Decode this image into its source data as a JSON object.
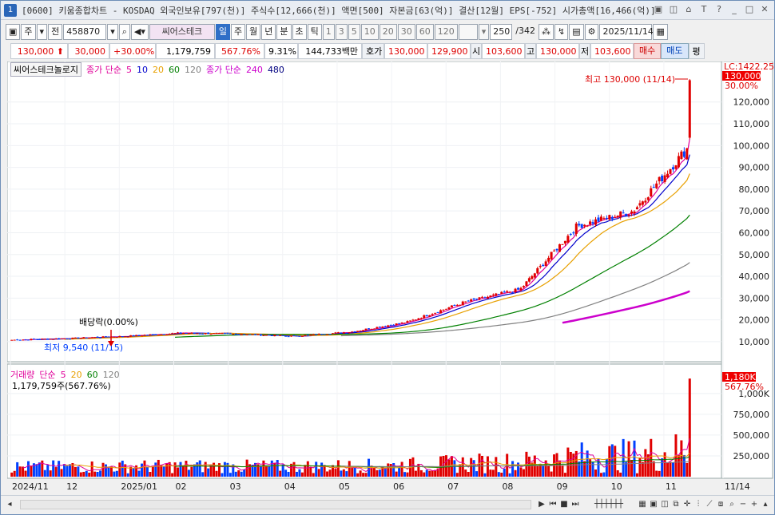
{
  "window": {
    "app_number": "1",
    "title": "[0600] 키움종합차트 - KOSDAQ 외국인보유[797(천)] 주식수[12,666(천)] 액면[500] 자본금[63(억)] 결산[12월] EPS[-752] 시가총액[16,466(억)]",
    "buttons": [
      "▣",
      "◫",
      "⌂",
      "T",
      "?",
      "_",
      "□",
      "✕"
    ]
  },
  "toolbar": {
    "period_combo": "주",
    "prev_label": "전",
    "code_value": "458870",
    "stock_name": "씨어스테크",
    "buttons": [
      "일",
      "주",
      "월",
      "년",
      "분",
      "초",
      "틱"
    ],
    "selected_period": "일",
    "numbers": [
      "1",
      "3",
      "5",
      "10",
      "20",
      "30",
      "60",
      "120"
    ],
    "count_value": "250",
    "count_total": "/342",
    "date_value": "2025/11/14"
  },
  "quote": {
    "price": "130,000",
    "change": "30,000",
    "change_pct": "+30.00%",
    "volume": "1,179,759",
    "vol_ratio": "567.76%",
    "turnover": "9.31%",
    "amount": "144,733백만",
    "ask_label": "호가",
    "ask": "130,000",
    "bid": "129,900",
    "open_label": "시",
    "open": "103,600",
    "high_label": "고",
    "high": "130,000",
    "low_label": "저",
    "low": "103,600",
    "buy_label": "매수",
    "sell_label": "매도",
    "eval_label": "평"
  },
  "legend_price": {
    "name": "씨어스테크놀로지",
    "ma_label": "종가 단순",
    "ma_periods": [
      "5",
      "10",
      "20",
      "60",
      "120"
    ],
    "ma2_label": "종가 단순",
    "ma2_periods": [
      "240",
      "480"
    ]
  },
  "legend_volume": {
    "name": "거래량",
    "ma_label": "단순",
    "ma_periods": [
      "5",
      "20",
      "60",
      "120"
    ],
    "info": "1,179,759주(567.76%)"
  },
  "annotations": {
    "high_note": "최고 130,000 (11/14)",
    "low_note": "최저 9,540 (11/15)",
    "dividend_note": "배당락(0.00%)",
    "lc_label": "LC:1422.25",
    "price_tag": "130,000",
    "pct_tag": "30.00%",
    "vol_tag": "1,180K",
    "vol_pct_tag": "567.76%"
  },
  "colors": {
    "up": "#e00000",
    "down": "#0040ff",
    "ma5": "#e0009a",
    "ma10": "#0000cc",
    "ma20": "#e8a000",
    "ma60": "#008000",
    "ma120": "#808080",
    "ma240": "#cc00cc",
    "ma480": "#000080"
  },
  "chart_data": [
    {
      "type": "candlestick",
      "title": "씨어스테크놀로지",
      "x": [
        "2024/11",
        "12",
        "2025/01",
        "02",
        "03",
        "04",
        "05",
        "06",
        "07",
        "08",
        "09",
        "10",
        "11",
        "11/14"
      ],
      "y_ticks": [
        "10,000",
        "20,000",
        "30,000",
        "40,000",
        "50,000",
        "60,000",
        "70,000",
        "80,000",
        "90,000",
        "100,000",
        "110,000",
        "120,000"
      ],
      "ylim": [
        3000,
        132000
      ],
      "monthly_close": [
        {
          "month": "2024/11",
          "close": 10800
        },
        {
          "month": "12",
          "close": 11500
        },
        {
          "month": "2025/01",
          "close": 12500
        },
        {
          "month": "02",
          "close": 14000
        },
        {
          "month": "03",
          "close": 13500
        },
        {
          "month": "04",
          "close": 12500
        },
        {
          "month": "05",
          "close": 14500
        },
        {
          "month": "06",
          "close": 19000
        },
        {
          "month": "07",
          "close": 28000
        },
        {
          "month": "08",
          "close": 34000
        },
        {
          "month": "09",
          "close": 63000
        },
        {
          "month": "10",
          "close": 70000
        },
        {
          "month": "11",
          "close": 100000
        },
        {
          "month": "11/14",
          "close": 130000
        }
      ],
      "last_close": 130000,
      "high": 130000,
      "low": 9540
    },
    {
      "type": "bar",
      "title": "거래량",
      "y_ticks": [
        "250,000",
        "500,000",
        "750,000",
        "1,000K"
      ],
      "ylim": [
        0,
        1200000
      ],
      "last_volume": 1179759
    }
  ]
}
